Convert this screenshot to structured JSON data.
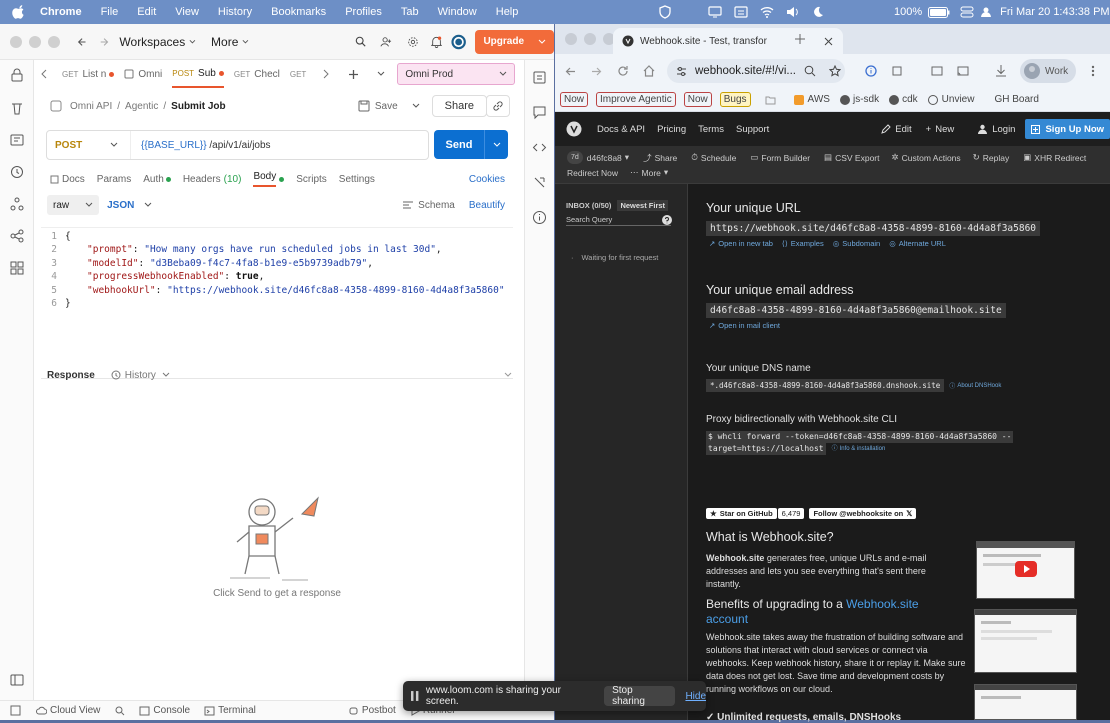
{
  "menubar": {
    "app": "Chrome",
    "items": [
      "File",
      "Edit",
      "View",
      "History",
      "Bookmarks",
      "Profiles",
      "Tab",
      "Window",
      "Help"
    ],
    "battery": "100%",
    "datetime": "Fri Mar 20  1:43:38 PM"
  },
  "postman": {
    "workspaces": "Workspaces",
    "more": "More",
    "upgrade": "Upgrade",
    "tabs": [
      {
        "method": "GET",
        "label": "List n",
        "dot": true
      },
      {
        "method": "",
        "label": "Omni",
        "dot": false
      },
      {
        "method": "POST",
        "label": "Sub",
        "dot": true
      },
      {
        "method": "GET",
        "label": "Checl",
        "dot": true
      },
      {
        "method": "GET",
        "label": "",
        "dot": false
      }
    ],
    "environment": "Omni Prod",
    "breadcrumb": [
      "Omni API",
      "Agentic",
      "Submit Job"
    ],
    "save": "Save",
    "share": "Share",
    "method": "POST",
    "url_var": "{{BASE_URL}}",
    "url_path": " /api/v1/ai/jobs",
    "send": "Send",
    "req_tabs": [
      {
        "label": "Docs",
        "active": false
      },
      {
        "label": "Params",
        "active": false
      },
      {
        "label": "Auth",
        "dot": "green",
        "active": false
      },
      {
        "label": "Headers",
        "count": "(10)",
        "active": false
      },
      {
        "label": "Body",
        "dot": "green",
        "active": true
      },
      {
        "label": "Scripts",
        "active": false
      },
      {
        "label": "Settings",
        "active": false
      }
    ],
    "cookies": "Cookies",
    "body_mode": "raw",
    "body_lang": "JSON",
    "schema": "Schema",
    "beautify": "Beautify",
    "code": [
      {
        "n": "1",
        "t": "{"
      },
      {
        "n": "2",
        "k": "\"prompt\"",
        "v": "\"How many orgs have run scheduled jobs in last 30d\"",
        "vt": "s",
        "c": ","
      },
      {
        "n": "3",
        "k": "\"modelId\"",
        "v": "\"d3Beba09-f4c7-4fa8-b1e9-e5b9739adb79\"",
        "vt": "s",
        "c": ","
      },
      {
        "n": "4",
        "k": "\"progressWebhookEnabled\"",
        "v": "true",
        "vt": "b",
        "c": ","
      },
      {
        "n": "5",
        "k": "\"webhookUrl\"",
        "v": "\"https://webhook.site/d46fc8a8-4358-4899-8160-4d4a8f3a5860\"",
        "vt": "s",
        "c": ""
      },
      {
        "n": "6",
        "t": "}"
      }
    ],
    "response": "Response",
    "history": "History",
    "empty_hint": "Click Send to get a response",
    "bottom": [
      "Cloud View",
      "Console",
      "Terminal",
      "Postbot",
      "Runner"
    ]
  },
  "browser": {
    "tab_title": "Webhook.site - Test, transfor",
    "address": "webhook.site/#!/vi...",
    "profile": "Work",
    "bookmarks": [
      "Now",
      "Improve Agentic",
      "Now",
      "Bugs",
      "AWS",
      "js-sdk",
      "cdk",
      "Unview",
      "GH Board"
    ]
  },
  "webhook": {
    "nav": [
      "Docs & API",
      "Pricing",
      "Terms",
      "Support"
    ],
    "edit": "Edit",
    "new": "New",
    "login": "Login",
    "signup": "Sign Up Now",
    "token_badge": "7d",
    "token_id": "d46fc8a8",
    "tools": [
      "Share",
      "Schedule",
      "Form Builder",
      "CSV Export",
      "Custom Actions",
      "Replay",
      "XHR Redirect",
      "Redirect Now",
      "More"
    ],
    "inbox": "INBOX (0/50)",
    "newest": "Newest First",
    "search": "Search Query",
    "waiting": "Waiting for first request",
    "unique_url_title": "Your unique URL",
    "unique_url": "https://webhook.site/d46fc8a8-4358-4899-8160-4d4a8f3a5860",
    "url_links": [
      "Open in new tab",
      "Examples",
      "Subdomain",
      "Alternate URL"
    ],
    "email_title": "Your unique email address",
    "email": "d46fc8a8-4358-4899-8160-4d4a8f3a5860@emailhook.site",
    "email_link": "Open in mail client",
    "dns_title": "Your unique DNS name",
    "dns": "*.d46fc8a8-4358-4899-8160-4d4a8f3a5860.dnshook.site",
    "dns_link": "About DNSHook",
    "cli_title": "Proxy bidirectionally with Webhook.site CLI",
    "cli_cmd1": "$ whcli forward --token=d46fc8a8-4358-4899-8160-4d4a8f3a5860 --",
    "cli_cmd2": "target=https://localhost",
    "cli_link": "Info & installation",
    "github_star": "Star on GitHub",
    "github_count": "6,479",
    "follow": "Follow @webhooksite on",
    "what_title": "What is Webhook.site?",
    "what_brand": "Webhook.site",
    "what_text": " generates free, unique URLs and e-mail addresses and lets you see everything that's sent there instantly.",
    "benefits_title": "Benefits of upgrading to a ",
    "benefits_link": "Webhook.site account",
    "benefits_text": "Webhook.site takes away the frustration of building software and solutions that interact with cloud services or connect via webhooks. Keep webhook history, share it or replay it. Make sure data does not get lost. Save time and development costs by running workflows on our cloud.",
    "unlimited": "Unlimited requests, emails, DNSHooks"
  },
  "loom": {
    "text": "www.loom.com is sharing your screen.",
    "stop": "Stop sharing",
    "hide": "Hide"
  }
}
